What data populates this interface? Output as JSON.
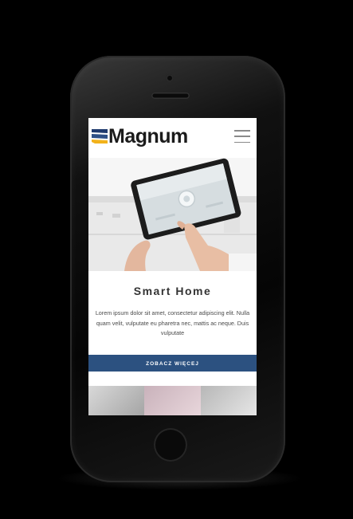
{
  "site": {
    "logo_text": "Magnum",
    "brand_colors": {
      "stripe_top": "#1f3a6e",
      "stripe_middle": "#2d4f86",
      "stripe_bottom": "#f2b21b",
      "button": "#2c5180"
    },
    "menu_icon": "hamburger-icon"
  },
  "hero": {
    "image": "hand-touching-tablet-smart-home"
  },
  "content": {
    "title": "Smart Home",
    "description": "Lorem ipsum dolor sit amet, consectetur adipiscing elit. Nulla quam velit, vulputate eu pharetra nec, mattis ac neque. Duis vulputate",
    "cta_label": "ZOBACZ WIĘCEJ"
  },
  "gallery": {
    "images": [
      "interior-photo-1",
      "interior-photo-2",
      "interior-photo-3"
    ]
  }
}
